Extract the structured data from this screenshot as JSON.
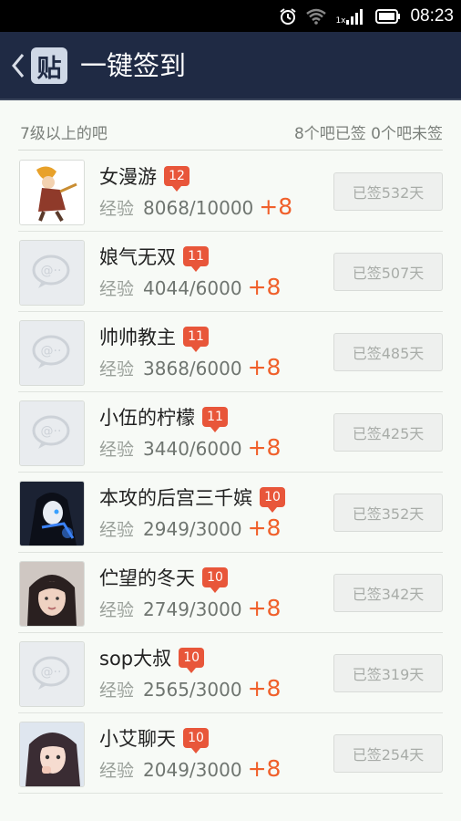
{
  "status_bar": {
    "time": "08:23",
    "network_label": "1x",
    "icons": [
      "alarm-icon",
      "wifi-icon",
      "signal-icon",
      "battery-icon"
    ]
  },
  "header": {
    "logo_text": "贴",
    "title": "一键签到",
    "back_icon": "chevron-left-icon"
  },
  "summary": {
    "left": "7级以上的吧",
    "right": "8个吧已签 0个吧未签"
  },
  "exp_label": "经验",
  "forums": [
    {
      "name": "女漫游",
      "level": "12",
      "exp": "8068/10000",
      "plus": "+8",
      "status": "已签532天",
      "avatar": "anime-warrior"
    },
    {
      "name": "娘气无双",
      "level": "11",
      "exp": "4044/6000",
      "plus": "+8",
      "status": "已签507天",
      "avatar": "default-chat"
    },
    {
      "name": "帅帅教主",
      "level": "11",
      "exp": "3868/6000",
      "plus": "+8",
      "status": "已签485天",
      "avatar": "default-chat"
    },
    {
      "name": "小伍的柠檬",
      "level": "11",
      "exp": "3440/6000",
      "plus": "+8",
      "status": "已签425天",
      "avatar": "default-chat"
    },
    {
      "name": "本攻的后宫三千嫔",
      "level": "10",
      "exp": "2949/3000",
      "plus": "+8",
      "status": "已签352天",
      "avatar": "anime-dark"
    },
    {
      "name": "伫望的冬天",
      "level": "10",
      "exp": "2749/3000",
      "plus": "+8",
      "status": "已签342天",
      "avatar": "girl-photo"
    },
    {
      "name": "sop大叔",
      "level": "10",
      "exp": "2565/3000",
      "plus": "+8",
      "status": "已签319天",
      "avatar": "default-chat"
    },
    {
      "name": "小艾聊天",
      "level": "10",
      "exp": "2049/3000",
      "plus": "+8",
      "status": "已签254天",
      "avatar": "girl-photo-2"
    }
  ],
  "colors": {
    "header_bg": "#1f2a44",
    "badge": "#e8563a",
    "plus": "#f0602b",
    "page_bg": "#f7faf6"
  }
}
